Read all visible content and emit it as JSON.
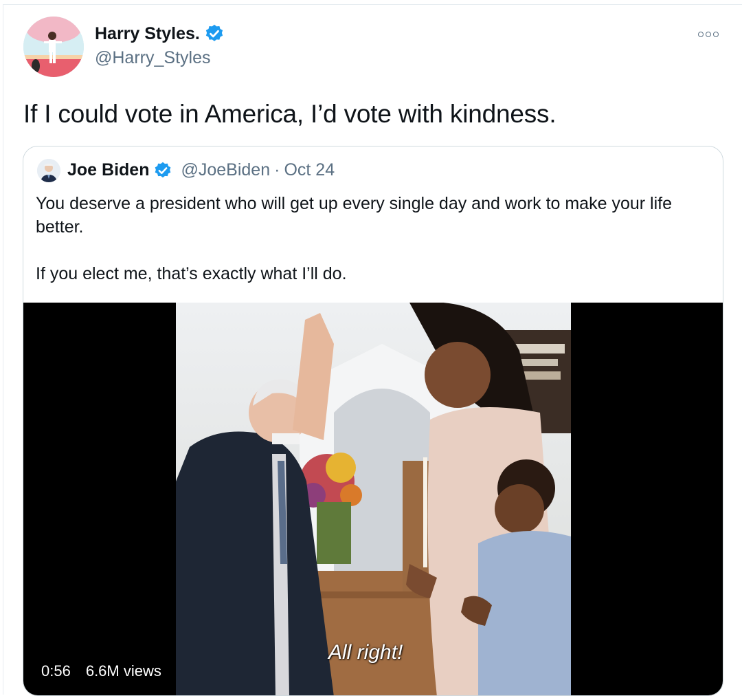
{
  "tweet": {
    "author": {
      "name": "Harry Styles.",
      "handle": "@Harry_Styles",
      "verified_icon": "verified-badge-icon",
      "avatar_icon": "profile-avatar"
    },
    "more_icon": "more-options-icon",
    "text": "If I could vote in America, I’d vote with kindness."
  },
  "quoted_tweet": {
    "author": {
      "name": "Joe Biden",
      "handle": "@JoeBiden",
      "verified_icon": "verified-badge-icon"
    },
    "separator": "·",
    "date": "Oct 24",
    "paragraphs": [
      "You deserve a president who will get up every single day and work to make your life better.",
      "If you elect me, that’s exactly what I’ll do."
    ],
    "media": {
      "subtitle": "All right!",
      "duration": "0:56",
      "views": "6.6M views"
    }
  },
  "colors": {
    "text_primary": "#0f1419",
    "text_secondary": "#5b7083",
    "verified_blue": "#1d9bf0",
    "border": "#cfd9de",
    "video_background": "#000000"
  }
}
